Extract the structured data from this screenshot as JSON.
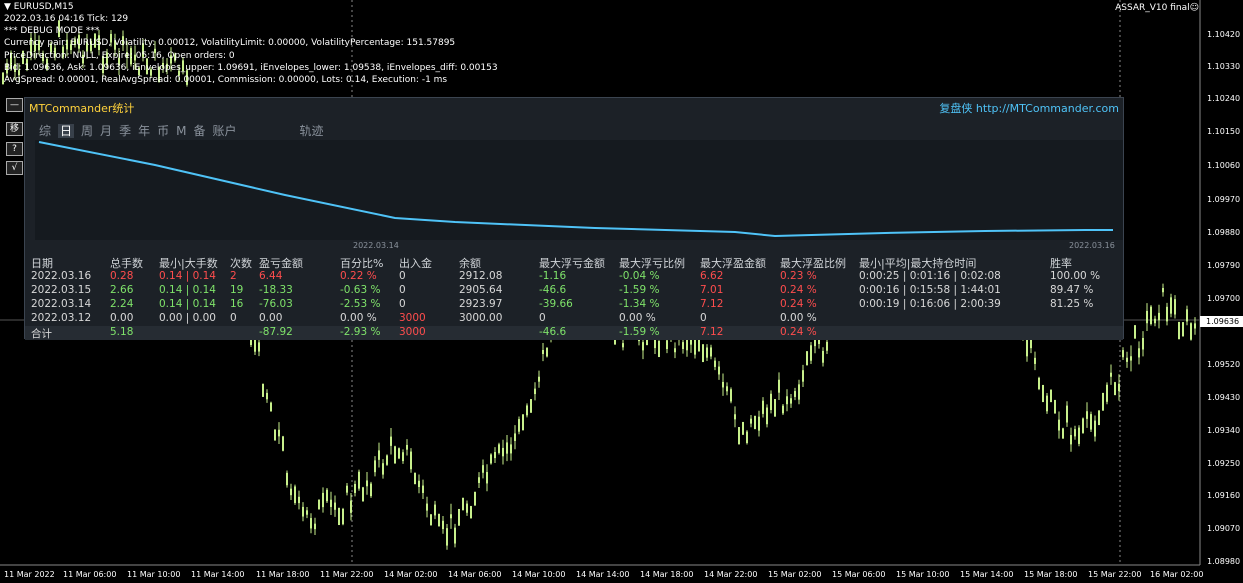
{
  "header": {
    "symbol": "▼ EURUSD,M15",
    "time_tick": "2022.03.16 04:16 Tick: 129",
    "debug": "*** DEBUG MODE ***",
    "line_currency": "Currency pair: EURUSD, Volatility: 0.00012, VolatilityLimit: 0.00000, VolatilityPercentage: 151.57895",
    "line_price": "PriceDirection: NULL, Expire: 05:16, Open orders: 0",
    "line_bid": "Bid: 1.09636, Ask: 1.09636, iEnvelopes_upper: 1.09691, iEnvelopes_lower: 1.09538, iEnvelopes_diff: 0.00153",
    "line_spread": "AvgSpread: 0.00001, RealAvgSpread: 0.00001, Commission: 0.00000, Lots: 0.14, Execution: -1 ms"
  },
  "ea_name": "ASSAR_V10 final☺",
  "price_scale": [
    "1.10420",
    "1.10330",
    "1.10240",
    "1.10150",
    "1.10060",
    "1.09970",
    "1.09880",
    "1.09790",
    "1.09700",
    "1.09520",
    "1.09430",
    "1.09340",
    "1.09250",
    "1.09160",
    "1.09070",
    "1.08980"
  ],
  "current_price": "1.09636",
  "time_axis": [
    "11 Mar 2022",
    "11 Mar 06:00",
    "11 Mar 10:00",
    "11 Mar 14:00",
    "11 Mar 18:00",
    "11 Mar 22:00",
    "14 Mar 02:00",
    "14 Mar 06:00",
    "14 Mar 10:00",
    "14 Mar 14:00",
    "14 Mar 18:00",
    "14 Mar 22:00",
    "15 Mar 02:00",
    "15 Mar 06:00",
    "15 Mar 10:00",
    "15 Mar 14:00",
    "15 Mar 18:00",
    "15 Mar 22:00",
    "16 Mar 02:00"
  ],
  "side_buttons": [
    "—",
    "移",
    "?",
    "√"
  ],
  "panel": {
    "title": "MTCommander统计",
    "link_label": "复盘侠",
    "link_url": "http://MTCommander.com",
    "tabs": [
      "综",
      "日",
      "周",
      "月",
      "季",
      "年",
      "币",
      "M",
      "备",
      "账户",
      "轨迹"
    ],
    "equity_dates": [
      "2022.03.14",
      "2022.03.16"
    ],
    "columns": [
      "日期",
      "总手数",
      "最小|大手数",
      "次数",
      "盈亏金额",
      "百分比%",
      "出入金",
      "余额",
      "最大浮亏金额",
      "最大浮亏比例",
      "最大浮盈金额",
      "最大浮盈比例",
      "最小|平均|最大持仓时间",
      "胜率"
    ],
    "rows": [
      [
        "2022.03.16",
        "0.28",
        "0.14 | 0.14",
        "2",
        "6.44",
        "0.22 %",
        "0",
        "2912.08",
        "-1.16",
        "-0.04 %",
        "6.62",
        "0.23 %",
        "0:00:25 | 0:01:16 | 0:02:08",
        "100.00 %"
      ],
      [
        "2022.03.15",
        "2.66",
        "0.14 | 0.14",
        "19",
        "-18.33",
        "-0.63 %",
        "0",
        "2905.64",
        "-46.6",
        "-1.59 %",
        "7.01",
        "0.24 %",
        "0:00:16 | 0:15:58 | 1:44:01",
        "89.47 %"
      ],
      [
        "2022.03.14",
        "2.24",
        "0.14 | 0.14",
        "16",
        "-76.03",
        "-2.53 %",
        "0",
        "2923.97",
        "-39.66",
        "-1.34 %",
        "7.12",
        "0.24 %",
        "0:00:19 | 0:16:06 | 2:00:39",
        "81.25 %"
      ],
      [
        "2022.03.12",
        "0.00",
        "0.00 | 0.00",
        "0",
        "0.00",
        "0.00 %",
        "3000",
        "3000.00",
        "0",
        "0.00 %",
        "0",
        "0.00 %",
        "",
        ""
      ]
    ],
    "total": [
      "合计",
      "5.18",
      "",
      "",
      "-87.92",
      "-2.93 %",
      "3000",
      "",
      "-46.6",
      "-1.59 %",
      "7.12",
      "0.24 %",
      "",
      ""
    ]
  },
  "colors": {
    "candle": "#c8f08c",
    "equity_line": "#4fc3f7",
    "title": "#ffd23c",
    "positive": "#7fe36a",
    "negative": "#ff4d4d"
  }
}
